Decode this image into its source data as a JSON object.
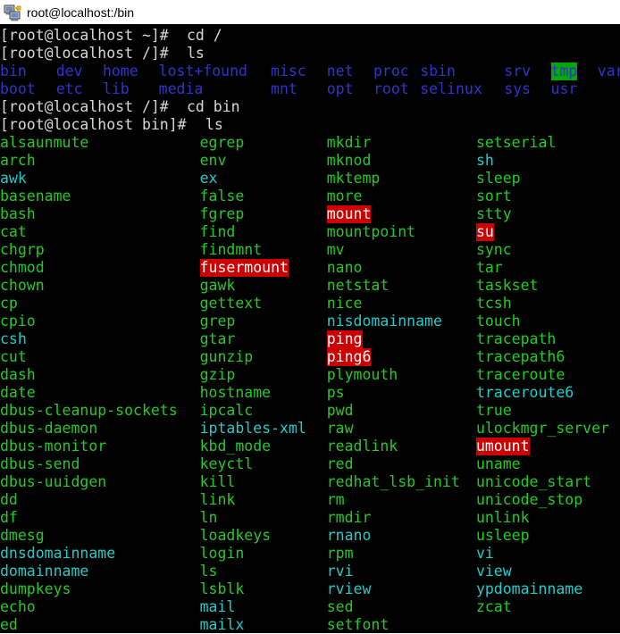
{
  "window": {
    "title": "root@localhost:/bin",
    "icon": "computer-network-icon"
  },
  "theme": {
    "background": "#000000",
    "prompt_fg": "#d8d8d8",
    "directory_fg": "#3333cc",
    "executable_fg": "#22cc22",
    "symlink_fg": "#22cccc",
    "sticky_bg": "#00aa00",
    "setuid_bg": "#cc0000",
    "setuid_fg": "#ffffff",
    "char_width": 10.45,
    "line_height": 20
  },
  "terminal": {
    "commands": [
      {
        "prompt": "[root@localhost ~]# ",
        "command": "cd /"
      },
      {
        "prompt": "[root@localhost /]# ",
        "command": "ls"
      },
      {
        "prompt": "[root@localhost /]# ",
        "command": "cd bin"
      },
      {
        "prompt": "[root@localhost bin]# ",
        "command": "ls"
      }
    ],
    "root_listing": {
      "columns": [
        0,
        6,
        11,
        17,
        29,
        35,
        40,
        45,
        54,
        59,
        64
      ],
      "rows": [
        [
          {
            "name": "bin",
            "type": "dir"
          },
          {
            "name": "dev",
            "type": "dir"
          },
          {
            "name": "home",
            "type": "dir"
          },
          {
            "name": "lost+found",
            "type": "dir"
          },
          {
            "name": "misc",
            "type": "dir"
          },
          {
            "name": "net",
            "type": "dir"
          },
          {
            "name": "proc",
            "type": "dir"
          },
          {
            "name": "sbin",
            "type": "dir"
          },
          {
            "name": "srv",
            "type": "dir"
          },
          {
            "name": "tmp",
            "type": "sticky"
          },
          {
            "name": "var",
            "type": "dir"
          }
        ],
        [
          {
            "name": "boot",
            "type": "dir"
          },
          {
            "name": "etc",
            "type": "dir"
          },
          {
            "name": "lib",
            "type": "dir"
          },
          {
            "name": "media",
            "type": "dir"
          },
          {
            "name": "mnt",
            "type": "dir"
          },
          {
            "name": "opt",
            "type": "dir"
          },
          {
            "name": "root",
            "type": "dir"
          },
          {
            "name": "selinux",
            "type": "dir"
          },
          {
            "name": "sys",
            "type": "dir"
          },
          {
            "name": "usr",
            "type": "dir"
          }
        ]
      ]
    },
    "bin_listing": {
      "columns": [
        0,
        21.4,
        35.0,
        51.0
      ],
      "rows": [
        [
          {
            "name": "alsaunmute",
            "type": "exec"
          },
          {
            "name": "egrep",
            "type": "exec"
          },
          {
            "name": "mkdir",
            "type": "exec"
          },
          {
            "name": "setserial",
            "type": "exec"
          }
        ],
        [
          {
            "name": "arch",
            "type": "exec"
          },
          {
            "name": "env",
            "type": "exec"
          },
          {
            "name": "mknod",
            "type": "exec"
          },
          {
            "name": "sh",
            "type": "link"
          }
        ],
        [
          {
            "name": "awk",
            "type": "link"
          },
          {
            "name": "ex",
            "type": "link"
          },
          {
            "name": "mktemp",
            "type": "exec"
          },
          {
            "name": "sleep",
            "type": "exec"
          }
        ],
        [
          {
            "name": "basename",
            "type": "exec"
          },
          {
            "name": "false",
            "type": "exec"
          },
          {
            "name": "more",
            "type": "exec"
          },
          {
            "name": "sort",
            "type": "exec"
          }
        ],
        [
          {
            "name": "bash",
            "type": "exec"
          },
          {
            "name": "fgrep",
            "type": "exec"
          },
          {
            "name": "mount",
            "type": "setuid"
          },
          {
            "name": "stty",
            "type": "exec"
          }
        ],
        [
          {
            "name": "cat",
            "type": "exec"
          },
          {
            "name": "find",
            "type": "exec"
          },
          {
            "name": "mountpoint",
            "type": "exec"
          },
          {
            "name": "su",
            "type": "setuid"
          }
        ],
        [
          {
            "name": "chgrp",
            "type": "exec"
          },
          {
            "name": "findmnt",
            "type": "exec"
          },
          {
            "name": "mv",
            "type": "exec"
          },
          {
            "name": "sync",
            "type": "exec"
          }
        ],
        [
          {
            "name": "chmod",
            "type": "exec"
          },
          {
            "name": "fusermount",
            "type": "setuid"
          },
          {
            "name": "nano",
            "type": "exec"
          },
          {
            "name": "tar",
            "type": "exec"
          }
        ],
        [
          {
            "name": "chown",
            "type": "exec"
          },
          {
            "name": "gawk",
            "type": "exec"
          },
          {
            "name": "netstat",
            "type": "exec"
          },
          {
            "name": "taskset",
            "type": "exec"
          }
        ],
        [
          {
            "name": "cp",
            "type": "exec"
          },
          {
            "name": "gettext",
            "type": "exec"
          },
          {
            "name": "nice",
            "type": "exec"
          },
          {
            "name": "tcsh",
            "type": "exec"
          }
        ],
        [
          {
            "name": "cpio",
            "type": "exec"
          },
          {
            "name": "grep",
            "type": "exec"
          },
          {
            "name": "nisdomainname",
            "type": "link"
          },
          {
            "name": "touch",
            "type": "exec"
          }
        ],
        [
          {
            "name": "csh",
            "type": "link"
          },
          {
            "name": "gtar",
            "type": "exec"
          },
          {
            "name": "ping",
            "type": "setuid"
          },
          {
            "name": "tracepath",
            "type": "exec"
          }
        ],
        [
          {
            "name": "cut",
            "type": "exec"
          },
          {
            "name": "gunzip",
            "type": "exec"
          },
          {
            "name": "ping6",
            "type": "setuid"
          },
          {
            "name": "tracepath6",
            "type": "exec"
          }
        ],
        [
          {
            "name": "dash",
            "type": "exec"
          },
          {
            "name": "gzip",
            "type": "exec"
          },
          {
            "name": "plymouth",
            "type": "exec"
          },
          {
            "name": "traceroute",
            "type": "exec"
          }
        ],
        [
          {
            "name": "date",
            "type": "exec"
          },
          {
            "name": "hostname",
            "type": "exec"
          },
          {
            "name": "ps",
            "type": "exec"
          },
          {
            "name": "traceroute6",
            "type": "link"
          }
        ],
        [
          {
            "name": "dbus-cleanup-sockets",
            "type": "exec"
          },
          {
            "name": "ipcalc",
            "type": "exec"
          },
          {
            "name": "pwd",
            "type": "exec"
          },
          {
            "name": "true",
            "type": "exec"
          }
        ],
        [
          {
            "name": "dbus-daemon",
            "type": "exec"
          },
          {
            "name": "iptables-xml",
            "type": "link"
          },
          {
            "name": "raw",
            "type": "exec"
          },
          {
            "name": "ulockmgr_server",
            "type": "exec"
          }
        ],
        [
          {
            "name": "dbus-monitor",
            "type": "exec"
          },
          {
            "name": "kbd_mode",
            "type": "exec"
          },
          {
            "name": "readlink",
            "type": "exec"
          },
          {
            "name": "umount",
            "type": "setuid"
          }
        ],
        [
          {
            "name": "dbus-send",
            "type": "exec"
          },
          {
            "name": "keyctl",
            "type": "exec"
          },
          {
            "name": "red",
            "type": "exec"
          },
          {
            "name": "uname",
            "type": "exec"
          }
        ],
        [
          {
            "name": "dbus-uuidgen",
            "type": "exec"
          },
          {
            "name": "kill",
            "type": "exec"
          },
          {
            "name": "redhat_lsb_init",
            "type": "exec"
          },
          {
            "name": "unicode_start",
            "type": "exec"
          }
        ],
        [
          {
            "name": "dd",
            "type": "exec"
          },
          {
            "name": "link",
            "type": "exec"
          },
          {
            "name": "rm",
            "type": "exec"
          },
          {
            "name": "unicode_stop",
            "type": "exec"
          }
        ],
        [
          {
            "name": "df",
            "type": "exec"
          },
          {
            "name": "ln",
            "type": "exec"
          },
          {
            "name": "rmdir",
            "type": "exec"
          },
          {
            "name": "unlink",
            "type": "exec"
          }
        ],
        [
          {
            "name": "dmesg",
            "type": "exec"
          },
          {
            "name": "loadkeys",
            "type": "exec"
          },
          {
            "name": "rnano",
            "type": "link"
          },
          {
            "name": "usleep",
            "type": "exec"
          }
        ],
        [
          {
            "name": "dnsdomainname",
            "type": "link"
          },
          {
            "name": "login",
            "type": "exec"
          },
          {
            "name": "rpm",
            "type": "exec"
          },
          {
            "name": "vi",
            "type": "link"
          }
        ],
        [
          {
            "name": "domainname",
            "type": "link"
          },
          {
            "name": "ls",
            "type": "exec"
          },
          {
            "name": "rvi",
            "type": "link"
          },
          {
            "name": "view",
            "type": "link"
          }
        ],
        [
          {
            "name": "dumpkeys",
            "type": "exec"
          },
          {
            "name": "lsblk",
            "type": "exec"
          },
          {
            "name": "rview",
            "type": "link"
          },
          {
            "name": "ypdomainname",
            "type": "link"
          }
        ],
        [
          {
            "name": "echo",
            "type": "exec"
          },
          {
            "name": "mail",
            "type": "link"
          },
          {
            "name": "sed",
            "type": "exec"
          },
          {
            "name": "zcat",
            "type": "exec"
          }
        ],
        [
          {
            "name": "ed",
            "type": "exec"
          },
          {
            "name": "mailx",
            "type": "link"
          },
          {
            "name": "setfont",
            "type": "exec"
          }
        ]
      ]
    }
  }
}
